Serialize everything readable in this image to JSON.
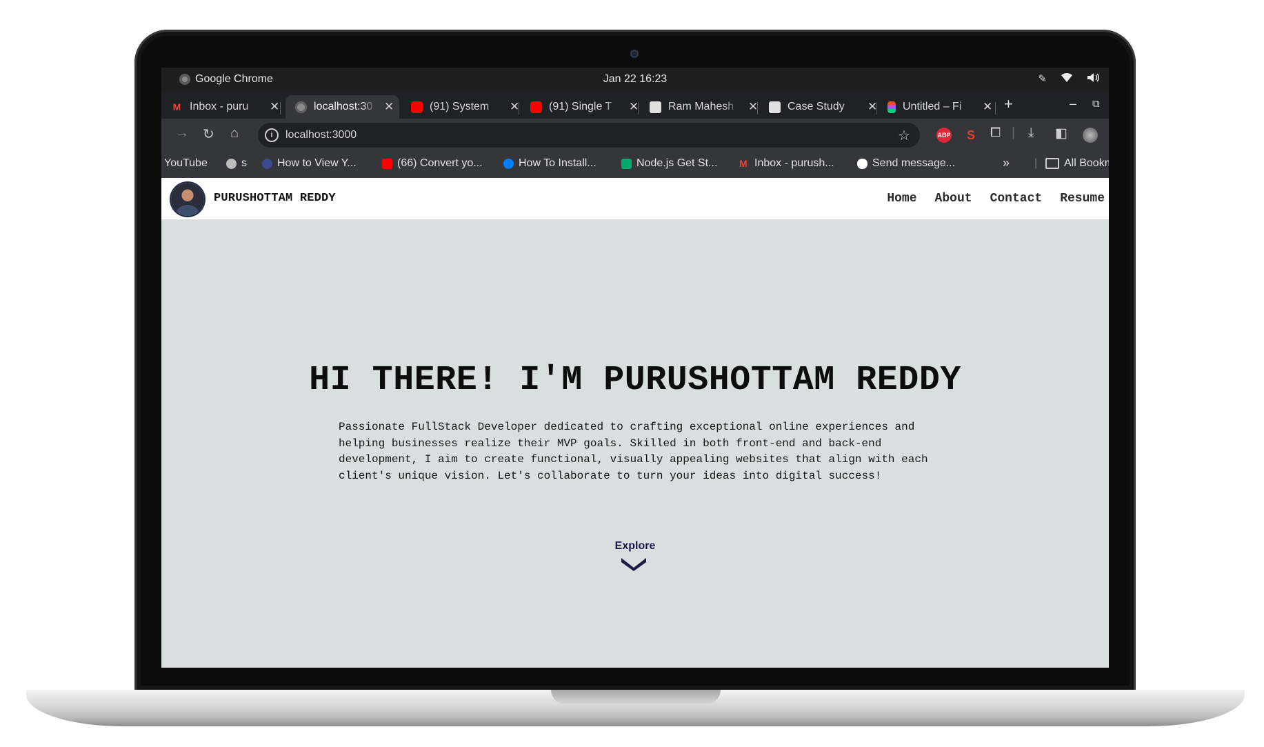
{
  "os": {
    "app_name": "Google Chrome",
    "clock": "Jan 22  16:23"
  },
  "tabs": [
    {
      "title": "Inbox - puru",
      "favicon": "gmail-icon",
      "color": "#ea4335",
      "active": false
    },
    {
      "title": "localhost:30",
      "favicon": "globe-icon",
      "color": "#8a8a8a",
      "active": true
    },
    {
      "title": "(91) System",
      "favicon": "youtube-icon",
      "color": "#ff0000",
      "active": false
    },
    {
      "title": "(91) Single T",
      "favicon": "youtube-icon",
      "color": "#ff0000",
      "active": false
    },
    {
      "title": "Ram Mahesh",
      "favicon": "profile-icon",
      "color": "#e0e0e0",
      "active": false
    },
    {
      "title": "Case Study",
      "favicon": "profile-icon",
      "color": "#e0e0e0",
      "active": false
    },
    {
      "title": "Untitled – Fi",
      "favicon": "figma-icon",
      "color": "#f24e1e",
      "active": false
    }
  ],
  "new_tab_label": "+",
  "toolbar": {
    "url": "localhost:3000",
    "ext_abp": "ABP"
  },
  "bookmarks": [
    {
      "label": "YouTube",
      "icon": "none",
      "color": ""
    },
    {
      "label": "s",
      "icon": "globe-icon",
      "color": "#bdbdbd"
    },
    {
      "label": "How to View Y...",
      "icon": "site-icon",
      "color": "#3b4b8f"
    },
    {
      "label": "(66) Convert yo...",
      "icon": "youtube-icon",
      "color": "#ff0000"
    },
    {
      "label": "How To Install...",
      "icon": "digitalocean-icon",
      "color": "#0080ff"
    },
    {
      "label": "Node.js Get St...",
      "icon": "w3-icon",
      "color": "#04aa6d"
    },
    {
      "label": "Inbox - purush...",
      "icon": "gmail-icon",
      "color": "#ea4335"
    },
    {
      "label": "Send message...",
      "icon": "medium-icon",
      "color": "#ffffff"
    }
  ],
  "bookmarks_more": "»",
  "all_bookmarks": "All Bookm",
  "site": {
    "brand": "PURUSHOTTAM REDDY",
    "nav": [
      "Home",
      "About",
      "Contact",
      "Resume"
    ],
    "hero_title": "HI THERE! I'M PURUSHOTTAM REDDY",
    "hero_text": "Passionate FullStack Developer dedicated to crafting exceptional online experiences and helping businesses realize their MVP goals. Skilled in both front-end and back-end development, I aim to create functional, visually appealing websites that align with each client's unique vision. Let's collaborate to turn your ideas into digital success!",
    "explore_label": "Explore",
    "accent": "#1a1a4a"
  }
}
